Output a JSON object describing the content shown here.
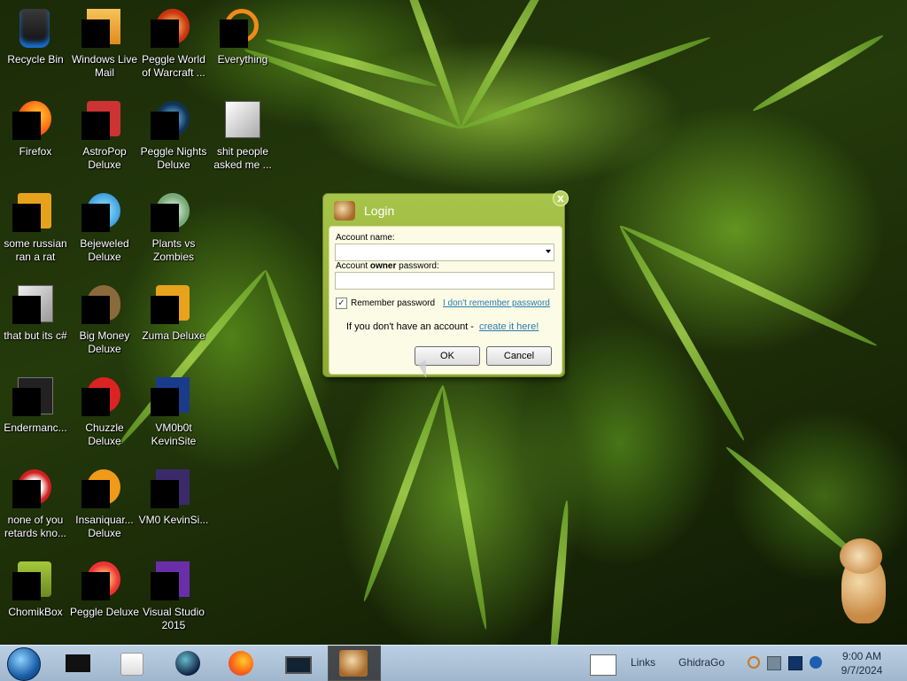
{
  "desktop": {
    "icons": [
      {
        "name": "recycle-bin",
        "label": "Recycle Bin"
      },
      {
        "name": "windows-live-mail",
        "label": "Windows Live Mail"
      },
      {
        "name": "peggle-world-of-warcraft",
        "label": "Peggle World of Warcraft ..."
      },
      {
        "name": "everything",
        "label": "Everything"
      },
      {
        "name": "firefox",
        "label": "Firefox"
      },
      {
        "name": "astropop-deluxe",
        "label": "AstroPop Deluxe"
      },
      {
        "name": "peggle-nights-deluxe",
        "label": "Peggle Nights Deluxe"
      },
      {
        "name": "shit-people-asked-me",
        "label": "shit people asked me ..."
      },
      {
        "name": "some-russian-ran-a-rat",
        "label": "some russian ran a rat"
      },
      {
        "name": "bejeweled-deluxe",
        "label": "Bejeweled Deluxe"
      },
      {
        "name": "plants-vs-zombies",
        "label": "Plants vs Zombies"
      },
      {
        "name": "that-but-its-csharp",
        "label": "that but its c#"
      },
      {
        "name": "big-money-deluxe",
        "label": "Big Money Deluxe"
      },
      {
        "name": "zuma-deluxe",
        "label": "Zuma Deluxe"
      },
      {
        "name": "endermanc",
        "label": "Endermanc..."
      },
      {
        "name": "chuzzle-deluxe",
        "label": "Chuzzle Deluxe"
      },
      {
        "name": "vm0b0t-kevinsite",
        "label": "VM0b0t KevinSite"
      },
      {
        "name": "none-of-you-retards",
        "label": "none of you retards kno..."
      },
      {
        "name": "insaniquarium-deluxe",
        "label": "Insaniquar... Deluxe"
      },
      {
        "name": "vm0-kevinsi",
        "label": "VM0 KevinSi..."
      },
      {
        "name": "chomikbox",
        "label": "ChomikBox"
      },
      {
        "name": "peggle-deluxe",
        "label": "Peggle Deluxe"
      },
      {
        "name": "visual-studio-2015",
        "label": "Visual Studio 2015"
      }
    ]
  },
  "login": {
    "title": "Login",
    "close": "x",
    "account_name_label": "Account name:",
    "account_name_value": "",
    "password_label_pre": "Account ",
    "password_label_bold": "owner",
    "password_label_post": " password:",
    "password_value": "",
    "remember_label": "Remember password",
    "remember_checked": true,
    "forgot_link": "I don't remember password",
    "no_account_text": "If you don't have an account - ",
    "create_link": "create it here!",
    "ok_label": "OK",
    "cancel_label": "Cancel"
  },
  "taskbar": {
    "links_label": "Links",
    "ghidrago_label": "GhidraGo",
    "time": "9:00 AM",
    "date": "9/7/2024"
  },
  "colors": {
    "dialog_green": "#98b53c",
    "link_blue": "#2a7ab0",
    "taskbar": "#aec3d8"
  }
}
